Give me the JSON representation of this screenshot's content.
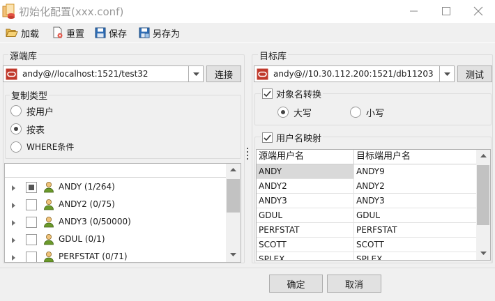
{
  "window": {
    "title": "初始化配置(xxx.conf)"
  },
  "toolbar": {
    "load": "加载",
    "reset": "重置",
    "save": "保存",
    "save_as": "另存为"
  },
  "source": {
    "legend": "源端库",
    "connection": "andy@//localhost:1521/test32",
    "connect_button": "连接",
    "copy_type": {
      "legend": "复制类型",
      "options": [
        "按用户",
        "按表",
        "WHERE条件"
      ],
      "selected": "按表"
    },
    "tree": {
      "filter_value": "",
      "items": [
        {
          "label": "ANDY (1/264)",
          "check": "partial"
        },
        {
          "label": "ANDY2 (0/75)",
          "check": "unchecked"
        },
        {
          "label": "ANDY3 (0/50000)",
          "check": "unchecked"
        },
        {
          "label": "GDUL (0/1)",
          "check": "unchecked"
        },
        {
          "label": "PERFSTAT (0/71)",
          "check": "unchecked"
        }
      ]
    }
  },
  "target": {
    "legend": "目标库",
    "connection": "andy@//10.30.112.200:1521/db11203",
    "test_button": "测试",
    "rename": {
      "legend": "对象名转换",
      "checked": true,
      "options": [
        "大写",
        "小写"
      ],
      "selected": "大写"
    },
    "user_mapping": {
      "legend": "用户名映射",
      "checked": true,
      "columns": [
        "源端用户名",
        "目标端用户名"
      ],
      "rows": [
        [
          "ANDY",
          "ANDY9"
        ],
        [
          "ANDY2",
          "ANDY2"
        ],
        [
          "ANDY3",
          "ANDY3"
        ],
        [
          "GDUL",
          "GDUL"
        ],
        [
          "PERFSTAT",
          "PERFSTAT"
        ],
        [
          "SCOTT",
          "SCOTT"
        ],
        [
          "SPLEX",
          "SPLEX"
        ]
      ]
    }
  },
  "footer": {
    "ok": "确定",
    "cancel": "取消"
  },
  "icons": {
    "app": "database-config-icon",
    "load": "folder-open-icon",
    "reset": "reset-document-icon",
    "save": "save-disk-icon",
    "save_as": "save-as-disk-icon",
    "oracle": "oracle-icon",
    "user": "user-icon"
  },
  "colors": {
    "oracle_red": "#c0392b",
    "selected_row": "#d9d9d9",
    "user_icon": "#6b9a2a"
  }
}
